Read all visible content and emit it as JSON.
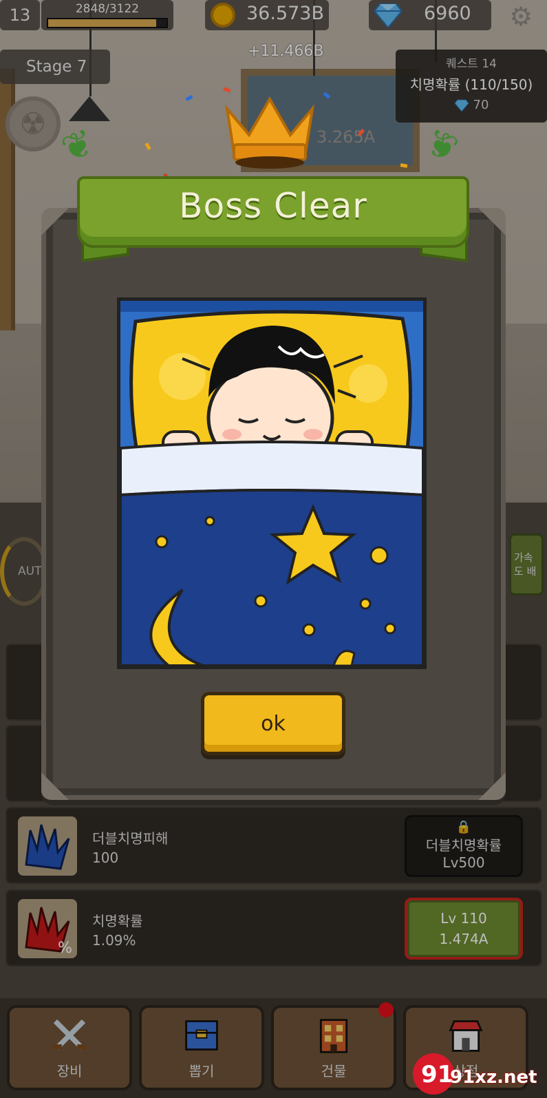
{
  "hud": {
    "player_level": "13",
    "xp_text": "2848/3122",
    "xp_progress": 0.912,
    "gold": "36.573B",
    "gems": "6960",
    "income_popup": "+11.466B",
    "stage": "Stage 7",
    "boss_hp_dim": "3.265A"
  },
  "quest": {
    "title": "퀘스트 14",
    "desc": "치명확률 (110/150)",
    "reward": "70"
  },
  "side": {
    "auto_label": "AUTO",
    "speed_label": "가속도 배"
  },
  "dialog": {
    "title": "Boss Clear",
    "ok_label": "ok"
  },
  "upgrades": [
    {
      "name": "더블치명피해",
      "value": "100",
      "btn_line1": "더블치명확률",
      "btn_line2": "Lv500",
      "locked": true
    },
    {
      "name": "치명확률",
      "value": "1.09%",
      "btn_line1": "Lv 110",
      "btn_line2": "1.474A",
      "locked": false
    }
  ],
  "nav": [
    {
      "label": "장비",
      "icon": "crossed-swords-icon"
    },
    {
      "label": "뽑기",
      "icon": "chest-icon"
    },
    {
      "label": "건물",
      "icon": "building-icon"
    },
    {
      "label": "상점",
      "icon": "shop-icon"
    }
  ],
  "watermark": "91xz.net",
  "colors": {
    "accent_gold": "#f1b91b",
    "banner_green": "#7aa22c",
    "alert_red": "#e0101a"
  }
}
